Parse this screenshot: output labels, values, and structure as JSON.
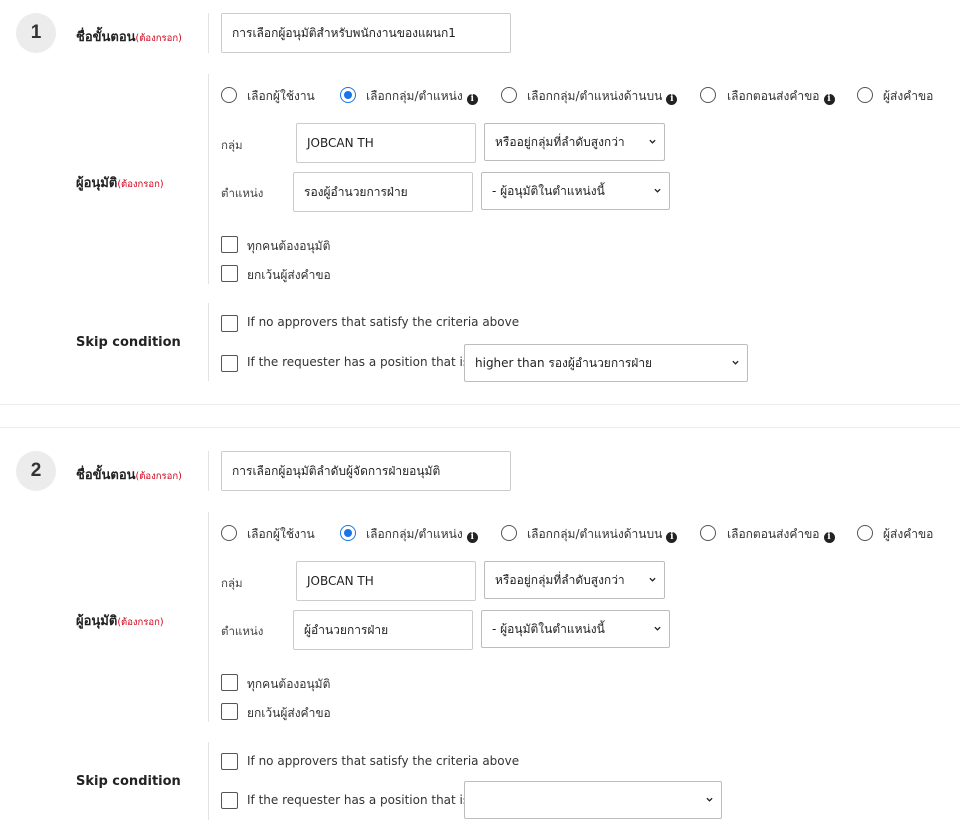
{
  "common": {
    "step_name_label": "ชื่อขั้นตอน",
    "required_tag": "(ต้องกรอก)",
    "approver_label": "ผู้อนุมัติ",
    "skip_label": "Skip condition",
    "radio_options": [
      "เลือกผู้ใช้งาน",
      "เลือกกลุ่ม/ตำแหน่ง",
      "เลือกกลุ่ม/ตำแหน่งด้านบน",
      "เลือกตอนส่งคำขอ",
      "ผู้ส่งคำขอ"
    ],
    "info_glyph": "i",
    "group_label": "กลุ่ม",
    "position_label": "ตำแหน่ง",
    "all_must_approve": "ทุกคนต้องอนุมัติ",
    "except_requester": "ยกเว้นผู้ส่งคำขอ",
    "skip_no_approvers": "If no approvers that satisfy the criteria above",
    "skip_requester_position": "If the requester has a position that is"
  },
  "steps": [
    {
      "number": "1",
      "step_name": "การเลือกผู้อนุมัติสำหรับพนักงานของแผนก1",
      "selected_radio": 1,
      "group_value": "JOBCAN TH",
      "group_scope": "หรืออยู่กลุ่มที่ลำดับสูงกว่า",
      "position_value": "รองผู้อำนวยการฝ่าย",
      "position_scope": "- ผู้อนุมัติในตำแหน่งนี้",
      "skip_position_select": "higher than รองผู้อำนวยการฝ่าย"
    },
    {
      "number": "2",
      "step_name": "การเลือกผู้อนุมัติลำดับผู้จัดการฝ่ายอนุมัติ",
      "selected_radio": 1,
      "group_value": "JOBCAN TH",
      "group_scope": "หรืออยู่กลุ่มที่ลำดับสูงกว่า",
      "position_value": "ผู้อำนวยการฝ่าย",
      "position_scope": "- ผู้อนุมัติในตำแหน่งนี้",
      "skip_position_select": ""
    }
  ],
  "colors": {
    "accent": "#1a73e8",
    "required": "#d0021b",
    "step_circle": "#ececec"
  }
}
